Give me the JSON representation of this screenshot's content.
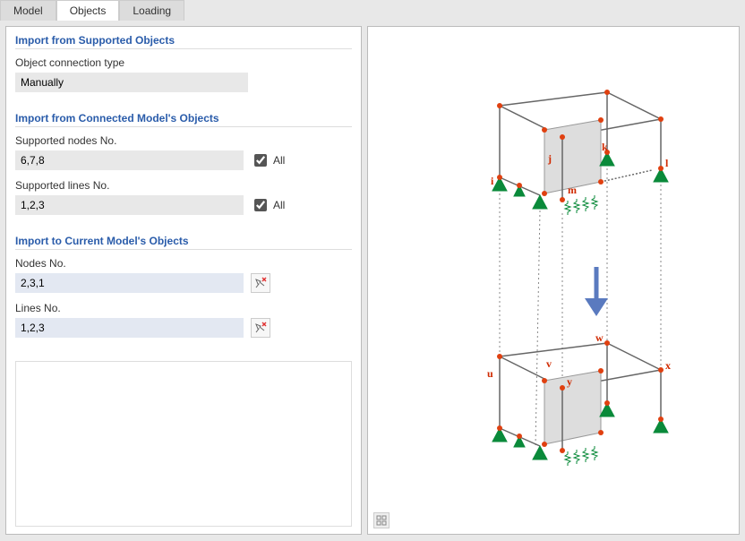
{
  "tabs": {
    "model": "Model",
    "objects": "Objects",
    "loading": "Loading",
    "active": "Objects"
  },
  "sections": {
    "supported": {
      "header": "Import from Supported Objects",
      "conn_type_label": "Object connection type",
      "conn_type_value": "Manually"
    },
    "connected": {
      "header": "Import from Connected Model's Objects",
      "nodes_label": "Supported nodes No.",
      "nodes_value": "6,7,8",
      "nodes_all": "All",
      "lines_label": "Supported lines No.",
      "lines_value": "1,2,3",
      "lines_all": "All"
    },
    "current": {
      "header": "Import to Current Model's Objects",
      "nodes_label": "Nodes No.",
      "nodes_value": "2,3,1",
      "lines_label": "Lines No.",
      "lines_value": "1,2,3"
    }
  },
  "diagram": {
    "top_labels": {
      "i": "i",
      "j": "j",
      "k": "k",
      "l": "l",
      "m": "m"
    },
    "bot_labels": {
      "u": "u",
      "v": "v",
      "w": "w",
      "x": "x",
      "y": "y"
    }
  }
}
